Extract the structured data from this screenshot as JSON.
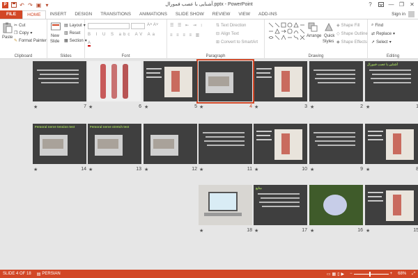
{
  "window": {
    "title": "آشنایی با عصب فمورال.pptx - PowerPoint",
    "help": "?",
    "minimize": "—",
    "restore": "❐",
    "close": "✕"
  },
  "tabs": [
    "FILE",
    "HOME",
    "INSERT",
    "DESIGN",
    "TRANSITIONS",
    "ANIMATIONS",
    "SLIDE SHOW",
    "REVIEW",
    "VIEW",
    "ADD-INS"
  ],
  "active_tab": "HOME",
  "sign_in": "Sign in",
  "ribbon": {
    "clipboard": {
      "paste": "Paste",
      "cut": "Cut",
      "copy": "Copy",
      "format_painter": "Format Painter",
      "label": "Clipboard"
    },
    "slides": {
      "new_slide": "New",
      "new_slide2": "Slide",
      "layout": "Layout",
      "reset": "Reset",
      "section": "Section",
      "label": "Slides"
    },
    "font": {
      "label": "Font"
    },
    "paragraph": {
      "text_direction": "Text Direction",
      "align_text": "Align Text",
      "smartart": "Convert to SmartArt",
      "label": "Paragraph"
    },
    "drawing": {
      "arrange": "Arrange",
      "quick_styles": "Quick",
      "quick_styles2": "Styles",
      "shape_fill": "Shape Fill",
      "shape_outline": "Shape Outline",
      "shape_effects": "Shape Effects",
      "label": "Drawing"
    },
    "editing": {
      "find": "Find",
      "replace": "Replace",
      "select": "Select",
      "label": "Editing"
    }
  },
  "slides": [
    {
      "num": "1",
      "heading": "آشنایی با عصب فمورال",
      "type": "title"
    },
    {
      "num": "2",
      "heading": "",
      "type": "text"
    },
    {
      "num": "3",
      "heading": "",
      "type": "diagram"
    },
    {
      "num": "4",
      "heading": "",
      "type": "photo"
    },
    {
      "num": "5",
      "heading": "",
      "type": "diagram"
    },
    {
      "num": "6",
      "heading": "",
      "type": "anatomy"
    },
    {
      "num": "7",
      "heading": "",
      "type": "text"
    },
    {
      "num": "8",
      "heading": "",
      "type": "diagram"
    },
    {
      "num": "9",
      "heading": "",
      "type": "text"
    },
    {
      "num": "10",
      "heading": "",
      "type": "diagram"
    },
    {
      "num": "11",
      "heading": "",
      "type": "text"
    },
    {
      "num": "12",
      "heading": "",
      "type": "photo"
    },
    {
      "num": "13",
      "heading": "Femoral nerve stretch test",
      "type": "photo"
    },
    {
      "num": "14",
      "heading": "Femoral nerve tension test",
      "type": "photo"
    },
    {
      "num": "15",
      "heading": "",
      "type": "diagram"
    },
    {
      "num": "16",
      "heading": "",
      "type": "flower"
    },
    {
      "num": "17",
      "heading": "منابع",
      "type": "text"
    },
    {
      "num": "18",
      "heading": "",
      "type": "laptop"
    }
  ],
  "status": {
    "slide_info": "SLIDE 4 OF 18",
    "language": "PERSIAN",
    "zoom": "68%"
  },
  "colors": {
    "accent": "#d24726",
    "slide_bg": "#3f3f3f",
    "slide_heading": "#a3d55b"
  }
}
